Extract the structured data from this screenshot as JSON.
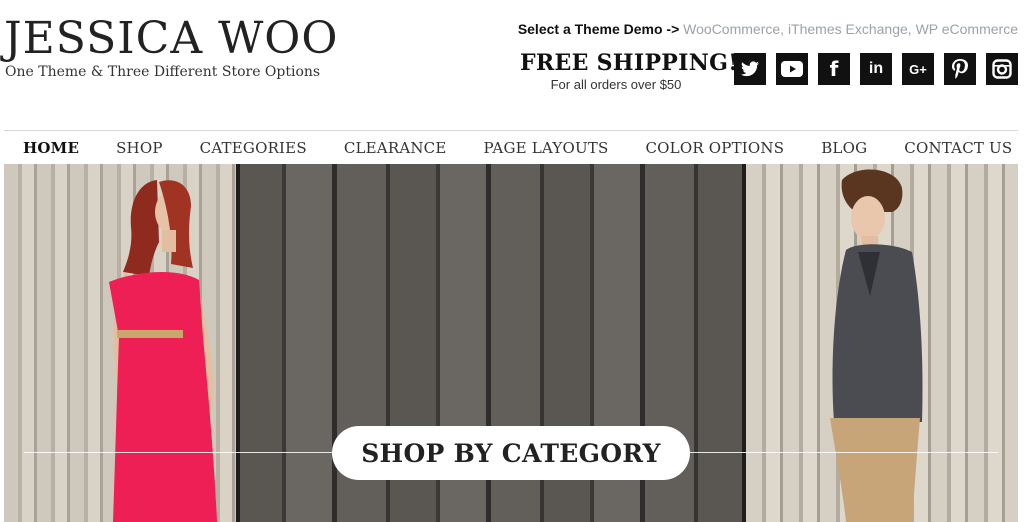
{
  "header": {
    "site_title": "JESSICA WOO",
    "tagline": "One Theme & Three Different Store Options",
    "theme_demo": {
      "lead": "Select a Theme Demo ->",
      "links": [
        "WooCommerce",
        "iThemes Exchange",
        "WP eCommerce"
      ],
      "separator": ", "
    },
    "shipping": {
      "headline": "FREE SHIPPING!",
      "subline": "For all orders over $50"
    },
    "social": [
      {
        "name": "twitter-icon",
        "glyph": "t"
      },
      {
        "name": "youtube-icon",
        "glyph": "▶"
      },
      {
        "name": "facebook-icon",
        "glyph": "f"
      },
      {
        "name": "linkedin-icon",
        "glyph": "in"
      },
      {
        "name": "google-plus-icon",
        "glyph": "G+"
      },
      {
        "name": "pinterest-icon",
        "glyph": "P"
      },
      {
        "name": "instagram-icon",
        "glyph": "◙"
      }
    ]
  },
  "nav": {
    "items": [
      "HOME",
      "SHOP",
      "CATEGORIES",
      "CLEARANCE",
      "PAGE LAYOUTS",
      "COLOR OPTIONS",
      "BLOG",
      "CONTACT US"
    ]
  },
  "hero": {
    "cta_label": "SHOP BY CATEGORY"
  },
  "colors": {
    "link": "#9aa3ab",
    "text": "#222222",
    "social_bg": "#111111"
  }
}
